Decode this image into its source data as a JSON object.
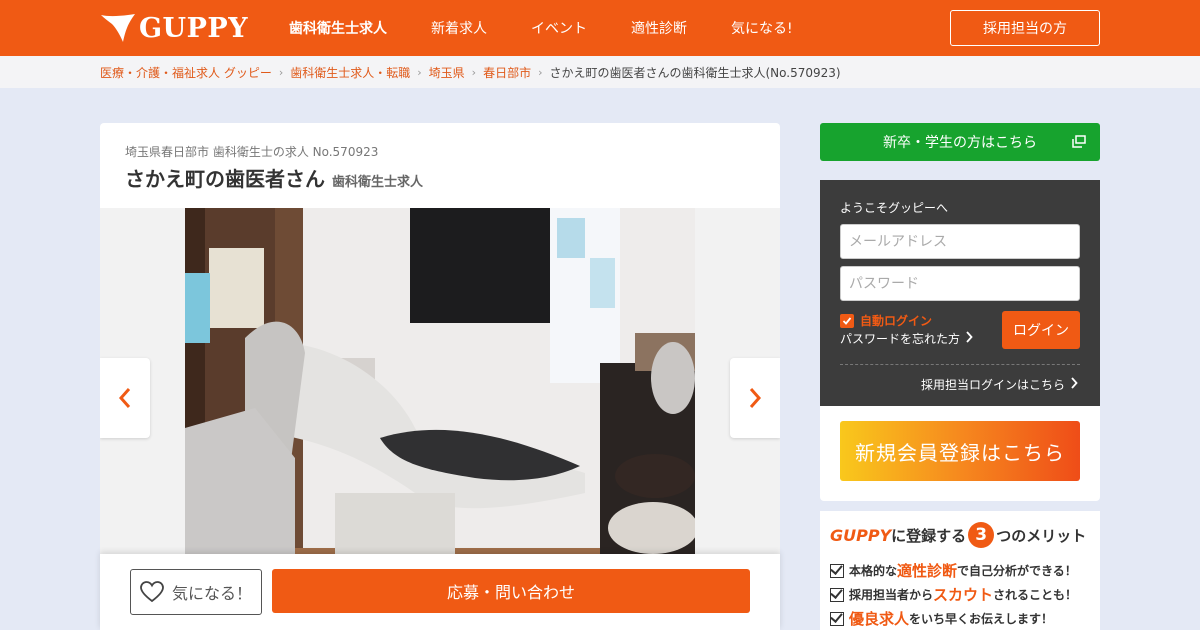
{
  "header": {
    "logo_text": "GUPPY",
    "nav": [
      "歯科衛生士求人",
      "新着求人",
      "イベント",
      "適性診断",
      "気になる!"
    ],
    "recruiter_button": "採用担当の方",
    "colors": {
      "brand": "#f05a14"
    }
  },
  "breadcrumb": [
    "医療・介護・福祉求人 グッピー",
    "歯科衛生士求人・転職",
    "埼玉県",
    "春日部市",
    "さかえ町の歯医者さんの歯科衛生士求人(No.570923)"
  ],
  "job": {
    "subtitle": "埼玉県春日部市 歯科衛生士の求人 No.570923",
    "title": "さかえ町の歯医者さん",
    "job_type": "歯科衛生士求人"
  },
  "actions": {
    "favorite_label": "気になる！",
    "apply_label": "応募・問い合わせ"
  },
  "sidebar": {
    "student_button": "新卒・学生の方はこちら",
    "login": {
      "welcome": "ようこそグッピーへ",
      "email_placeholder": "メールアドレス",
      "password_placeholder": "パスワード",
      "auto_login": "自動ログイン",
      "forgot_password": "パスワードを忘れた方",
      "login_button": "ログイン",
      "recruiter_login": "採用担当ログインはこちら"
    },
    "register_button": "新規会員登録はこちら",
    "merits": {
      "title_brand": "GUPPY",
      "title_pre": "に登録する",
      "title_num": "3",
      "title_post": "つのメリット",
      "rows": [
        {
          "pre": "本格的な",
          "em": "適性診断",
          "post": "で自己分析ができる！"
        },
        {
          "pre": "採用担当者から",
          "em": "スカウト",
          "post": "されることも！"
        },
        {
          "pre": "",
          "em": "優良求人",
          "post": "をいち早くお伝えします！"
        }
      ]
    }
  }
}
